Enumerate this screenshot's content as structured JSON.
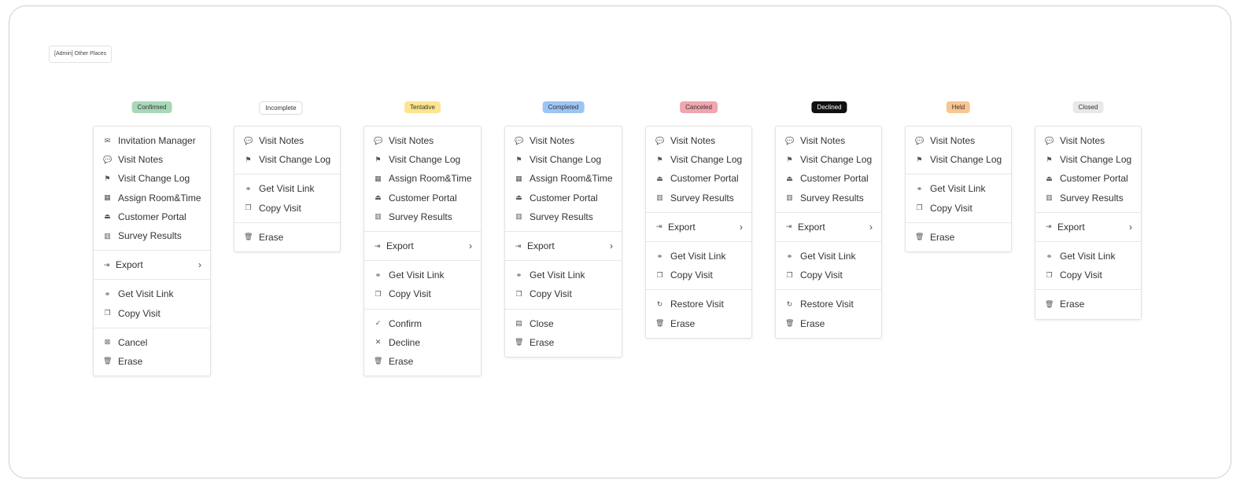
{
  "page_tag": "[Admin] Other Places",
  "columns": [
    {
      "status": "Confirmed",
      "badge_color": "#a8d8b9",
      "groups": [
        [
          {
            "label": "Invitation Manager",
            "icon": "mail-icon"
          },
          {
            "label": "Visit Notes",
            "icon": "chat-icon"
          },
          {
            "label": "Visit Change Log",
            "icon": "flag-icon"
          },
          {
            "label": "Assign Room&Time",
            "icon": "calendar-icon"
          },
          {
            "label": "Customer Portal",
            "icon": "portal-icon"
          },
          {
            "label": "Survey Results",
            "icon": "bar-chart-icon"
          }
        ],
        [
          {
            "label": "Export",
            "icon": "export-icon",
            "submenu": true
          }
        ],
        [
          {
            "label": "Get Visit Link",
            "icon": "link-icon"
          },
          {
            "label": "Copy Visit",
            "icon": "copy-icon"
          }
        ],
        [
          {
            "label": "Cancel",
            "icon": "calendar-x-icon"
          },
          {
            "label": "Erase",
            "icon": "trash-icon"
          }
        ]
      ]
    },
    {
      "status": "Incomplete",
      "badge_color": "#ffffff",
      "groups": [
        [
          {
            "label": "Visit Notes",
            "icon": "chat-icon"
          },
          {
            "label": "Visit Change Log",
            "icon": "flag-icon"
          }
        ],
        [
          {
            "label": "Get Visit Link",
            "icon": "link-icon"
          },
          {
            "label": "Copy Visit",
            "icon": "copy-icon"
          }
        ],
        [
          {
            "label": "Erase",
            "icon": "trash-icon"
          }
        ]
      ]
    },
    {
      "status": "Tentative",
      "badge_color": "#fbe58e",
      "groups": [
        [
          {
            "label": "Visit Notes",
            "icon": "chat-icon"
          },
          {
            "label": "Visit Change Log",
            "icon": "flag-icon"
          },
          {
            "label": "Assign Room&Time",
            "icon": "calendar-icon"
          },
          {
            "label": "Customer Portal",
            "icon": "portal-icon"
          },
          {
            "label": "Survey Results",
            "icon": "bar-chart-icon"
          }
        ],
        [
          {
            "label": "Export",
            "icon": "export-icon",
            "submenu": true
          }
        ],
        [
          {
            "label": "Get Visit Link",
            "icon": "link-icon"
          },
          {
            "label": "Copy Visit",
            "icon": "copy-icon"
          }
        ],
        [
          {
            "label": "Confirm",
            "icon": "check-icon"
          },
          {
            "label": "Decline",
            "icon": "x-icon"
          },
          {
            "label": "Erase",
            "icon": "trash-icon"
          }
        ]
      ]
    },
    {
      "status": "Completed",
      "badge_color": "#9cc4f5",
      "groups": [
        [
          {
            "label": "Visit Notes",
            "icon": "chat-icon"
          },
          {
            "label": "Visit Change Log",
            "icon": "flag-icon"
          },
          {
            "label": "Assign Room&Time",
            "icon": "calendar-icon"
          },
          {
            "label": "Customer Portal",
            "icon": "portal-icon"
          },
          {
            "label": "Survey Results",
            "icon": "bar-chart-icon"
          }
        ],
        [
          {
            "label": "Export",
            "icon": "export-icon",
            "submenu": true
          }
        ],
        [
          {
            "label": "Get Visit Link",
            "icon": "link-icon"
          },
          {
            "label": "Copy Visit",
            "icon": "copy-icon"
          }
        ],
        [
          {
            "label": "Close",
            "icon": "archive-icon"
          },
          {
            "label": "Erase",
            "icon": "trash-icon"
          }
        ]
      ]
    },
    {
      "status": "Canceled",
      "badge_color": "#f1a6ae",
      "groups": [
        [
          {
            "label": "Visit Notes",
            "icon": "chat-icon"
          },
          {
            "label": "Visit Change Log",
            "icon": "flag-icon"
          },
          {
            "label": "Customer Portal",
            "icon": "portal-icon"
          },
          {
            "label": "Survey Results",
            "icon": "bar-chart-icon"
          }
        ],
        [
          {
            "label": "Export",
            "icon": "export-icon",
            "submenu": true
          }
        ],
        [
          {
            "label": "Get Visit Link",
            "icon": "link-icon"
          },
          {
            "label": "Copy Visit",
            "icon": "copy-icon"
          }
        ],
        [
          {
            "label": "Restore Visit",
            "icon": "restore-icon"
          },
          {
            "label": "Erase",
            "icon": "trash-icon"
          }
        ]
      ]
    },
    {
      "status": "Declined",
      "badge_color": "#111111",
      "groups": [
        [
          {
            "label": "Visit Notes",
            "icon": "chat-icon"
          },
          {
            "label": "Visit Change Log",
            "icon": "flag-icon"
          },
          {
            "label": "Customer Portal",
            "icon": "portal-icon"
          },
          {
            "label": "Survey Results",
            "icon": "bar-chart-icon"
          }
        ],
        [
          {
            "label": "Export",
            "icon": "export-icon",
            "submenu": true
          }
        ],
        [
          {
            "label": "Get Visit Link",
            "icon": "link-icon"
          },
          {
            "label": "Copy Visit",
            "icon": "copy-icon"
          }
        ],
        [
          {
            "label": "Restore Visit",
            "icon": "restore-icon"
          },
          {
            "label": "Erase",
            "icon": "trash-icon"
          }
        ]
      ]
    },
    {
      "status": "Held",
      "badge_color": "#f9c590",
      "groups": [
        [
          {
            "label": "Visit Notes",
            "icon": "chat-icon"
          },
          {
            "label": "Visit Change Log",
            "icon": "flag-icon"
          }
        ],
        [
          {
            "label": "Get Visit Link",
            "icon": "link-icon"
          },
          {
            "label": "Copy Visit",
            "icon": "copy-icon"
          }
        ],
        [
          {
            "label": "Erase",
            "icon": "trash-icon"
          }
        ]
      ]
    },
    {
      "status": "Closed",
      "badge_color": "#e8e8e8",
      "groups": [
        [
          {
            "label": "Visit Notes",
            "icon": "chat-icon"
          },
          {
            "label": "Visit Change Log",
            "icon": "flag-icon"
          },
          {
            "label": "Customer Portal",
            "icon": "portal-icon"
          },
          {
            "label": "Survey Results",
            "icon": "bar-chart-icon"
          }
        ],
        [
          {
            "label": "Export",
            "icon": "export-icon",
            "submenu": true
          }
        ],
        [
          {
            "label": "Get Visit Link",
            "icon": "link-icon"
          },
          {
            "label": "Copy Visit",
            "icon": "copy-icon"
          }
        ],
        [
          {
            "label": "Erase",
            "icon": "trash-icon"
          }
        ]
      ]
    }
  ]
}
